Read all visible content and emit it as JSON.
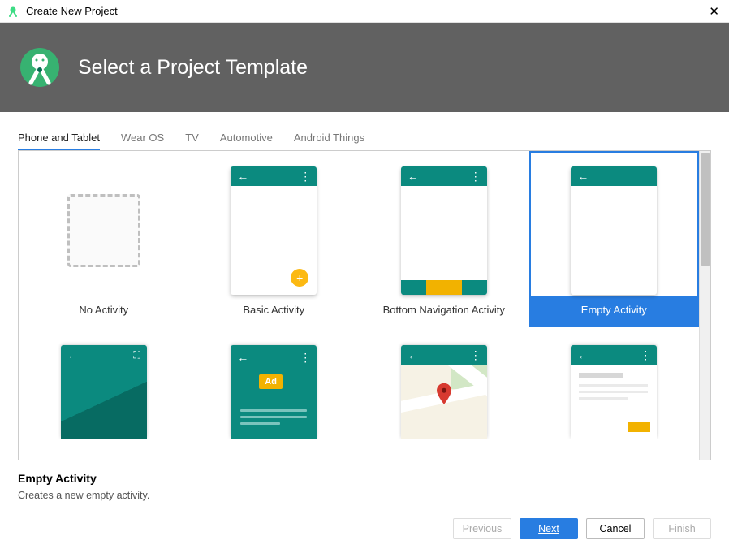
{
  "window": {
    "title": "Create New Project"
  },
  "header": {
    "title": "Select a Project Template"
  },
  "tabs": [
    {
      "label": "Phone and Tablet",
      "active": true
    },
    {
      "label": "Wear OS",
      "active": false
    },
    {
      "label": "TV",
      "active": false
    },
    {
      "label": "Automotive",
      "active": false
    },
    {
      "label": "Android Things",
      "active": false
    }
  ],
  "templates_row1": [
    {
      "label": "No Activity",
      "kind": "none",
      "selected": false
    },
    {
      "label": "Basic Activity",
      "kind": "basic",
      "selected": false
    },
    {
      "label": "Bottom Navigation Activity",
      "kind": "bottomnav",
      "selected": false
    },
    {
      "label": "Empty Activity",
      "kind": "empty",
      "selected": true
    }
  ],
  "templates_row2": [
    {
      "kind": "fullscreen"
    },
    {
      "kind": "admob"
    },
    {
      "kind": "maps"
    },
    {
      "kind": "masterdetail"
    }
  ],
  "ad_label": "Ad",
  "info": {
    "title": "Empty Activity",
    "desc": "Creates a new empty activity."
  },
  "footer": {
    "previous": "Previous",
    "next": "Next",
    "cancel": "Cancel",
    "finish": "Finish"
  }
}
